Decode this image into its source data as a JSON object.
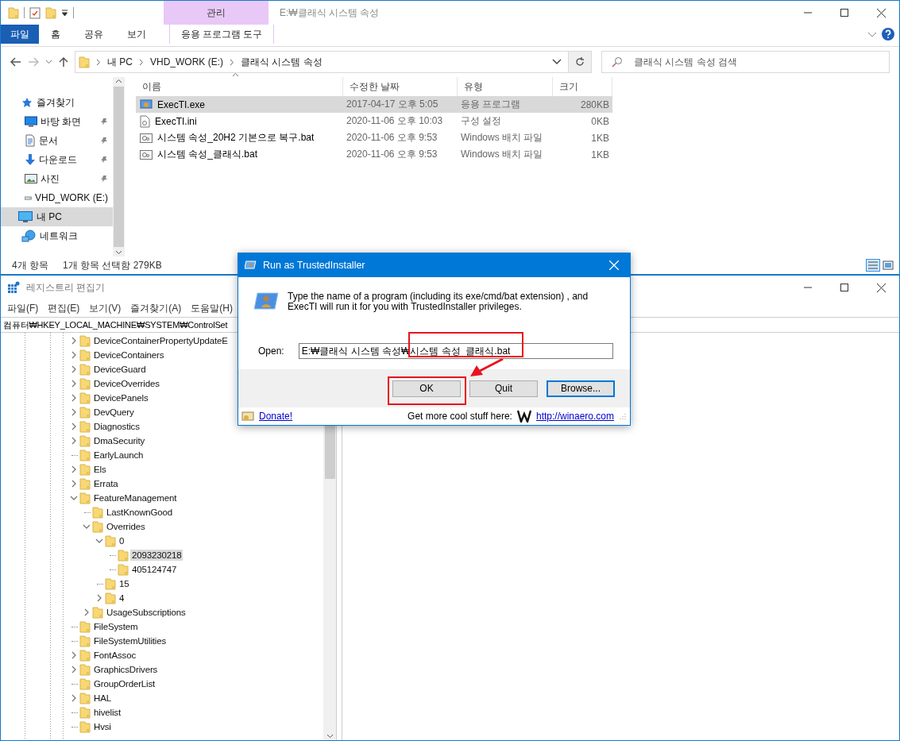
{
  "explorer": {
    "title": "E:₩클래식 시스템 속성",
    "context_tab_group": "관리",
    "ribbon_tabs": [
      {
        "label": "파일",
        "selected": false,
        "kind": "file"
      },
      {
        "label": "홈",
        "selected": false,
        "kind": "tab"
      },
      {
        "label": "공유",
        "selected": false,
        "kind": "tab"
      },
      {
        "label": "보기",
        "selected": false,
        "kind": "tab"
      },
      {
        "label": "응용 프로그램 도구",
        "selected": false,
        "kind": "context"
      }
    ],
    "breadcrumbs": [
      "내 PC",
      "VHD_WORK (E:)",
      "클래식 시스템 속성"
    ],
    "search": {
      "placeholder": "클래식 시스템 속성 검색"
    },
    "nav_items": [
      {
        "label": "즐겨찾기",
        "kind": "star",
        "pinned": false,
        "selected": false,
        "indent": false
      },
      {
        "label": "바탕 화면",
        "kind": "desktop",
        "pinned": true,
        "selected": false,
        "indent": true
      },
      {
        "label": "문서",
        "kind": "document",
        "pinned": true,
        "selected": false,
        "indent": true
      },
      {
        "label": "다운로드",
        "kind": "download",
        "pinned": true,
        "selected": false,
        "indent": true
      },
      {
        "label": "사진",
        "kind": "pictures",
        "pinned": true,
        "selected": false,
        "indent": true
      },
      {
        "label": "VHD_WORK (E:)",
        "kind": "drive",
        "pinned": false,
        "selected": false,
        "indent": true
      },
      {
        "label": "내 PC",
        "kind": "pc",
        "pinned": false,
        "selected": true,
        "indent": false
      },
      {
        "label": "네트워크",
        "kind": "network",
        "pinned": false,
        "selected": false,
        "indent": false
      }
    ],
    "columns": [
      "이름",
      "수정한 날짜",
      "유형",
      "크기"
    ],
    "files": [
      {
        "name": "ExecTI.exe",
        "kind": "exe",
        "modified": "2017-04-17 오후 5:05",
        "type": "응용 프로그램",
        "size": "280KB",
        "selected": true
      },
      {
        "name": "ExecTI.ini",
        "kind": "ini",
        "modified": "2020-11-06 오후 10:03",
        "type": "구성 설정",
        "size": "0KB",
        "selected": false
      },
      {
        "name": "시스템 속성_20H2 기본으로 복구.bat",
        "kind": "bat",
        "modified": "2020-11-06 오후 9:53",
        "type": "Windows 배치 파일",
        "size": "1KB",
        "selected": false
      },
      {
        "name": "시스템 속성_클래식.bat",
        "kind": "bat",
        "modified": "2020-11-06 오후 9:53",
        "type": "Windows 배치 파일",
        "size": "1KB",
        "selected": false
      }
    ],
    "status_bar": [
      "4개 항목",
      "1개 항목 선택함 279KB"
    ]
  },
  "regedit": {
    "title": "레지스트리 편집기",
    "menu": [
      "파일(F)",
      "편집(E)",
      "보기(V)",
      "즐겨찾기(A)",
      "도움말(H)"
    ],
    "address": "컴퓨터₩HKEY_LOCAL_MACHINE₩SYSTEM₩ControlSet",
    "tree": [
      {
        "name": "DeviceContainerPropertyUpdateE",
        "expandable": true,
        "expanded": false,
        "selected": false
      },
      {
        "name": "DeviceContainers",
        "expandable": true,
        "expanded": false,
        "selected": false
      },
      {
        "name": "DeviceGuard",
        "expandable": true,
        "expanded": false,
        "selected": false
      },
      {
        "name": "DeviceOverrides",
        "expandable": true,
        "expanded": false,
        "selected": false
      },
      {
        "name": "DevicePanels",
        "expandable": true,
        "expanded": false,
        "selected": false
      },
      {
        "name": "DevQuery",
        "expandable": true,
        "expanded": false,
        "selected": false
      },
      {
        "name": "Diagnostics",
        "expandable": true,
        "expanded": false,
        "selected": false
      },
      {
        "name": "DmaSecurity",
        "expandable": true,
        "expanded": false,
        "selected": false
      },
      {
        "name": "EarlyLaunch",
        "expandable": false,
        "selected": false
      },
      {
        "name": "Els",
        "expandable": true,
        "expanded": false,
        "selected": false
      },
      {
        "name": "Errata",
        "expandable": true,
        "expanded": false,
        "selected": false
      },
      {
        "name": "FeatureManagement",
        "expandable": true,
        "expanded": true,
        "selected": false,
        "children": [
          {
            "name": "LastKnownGood",
            "expandable": false,
            "selected": false
          },
          {
            "name": "Overrides",
            "expandable": true,
            "expanded": true,
            "selected": false,
            "children": [
              {
                "name": "0",
                "expandable": true,
                "expanded": true,
                "selected": false,
                "children": [
                  {
                    "name": "2093230218",
                    "expandable": false,
                    "selected": true
                  },
                  {
                    "name": "405124747",
                    "expandable": false,
                    "selected": false
                  }
                ]
              },
              {
                "name": "15",
                "expandable": false,
                "selected": false
              },
              {
                "name": "4",
                "expandable": true,
                "expanded": false,
                "selected": false
              }
            ]
          },
          {
            "name": "UsageSubscriptions",
            "expandable": true,
            "expanded": false,
            "selected": false
          }
        ]
      },
      {
        "name": "FileSystem",
        "expandable": false,
        "selected": false
      },
      {
        "name": "FileSystemUtilities",
        "expandable": false,
        "selected": false
      },
      {
        "name": "FontAssoc",
        "expandable": true,
        "expanded": false,
        "selected": false
      },
      {
        "name": "GraphicsDrivers",
        "expandable": true,
        "expanded": false,
        "selected": false
      },
      {
        "name": "GroupOrderList",
        "expandable": false,
        "selected": false
      },
      {
        "name": "HAL",
        "expandable": true,
        "expanded": false,
        "selected": false
      },
      {
        "name": "hivelist",
        "expandable": false,
        "selected": false
      },
      {
        "name": "Hvsi",
        "expandable": false,
        "selected": false
      }
    ]
  },
  "dialog": {
    "title": "Run as TrustedInstaller",
    "message": "Type the name of a program (including its exe/cmd/bat extension) , and ExecTI will run it for you with TrustedInstaller privileges.",
    "open_label": "Open:",
    "open_value": "E:₩클래식 시스템 속성₩시스템 속성_클래식.bat",
    "buttons": [
      {
        "label": "OK",
        "default": false
      },
      {
        "label": "Quit",
        "default": false
      },
      {
        "label": "Browse...",
        "default": true
      }
    ],
    "donate": "Donate!",
    "promo": "Get more cool stuff here:",
    "link": "http://winaero.com"
  }
}
